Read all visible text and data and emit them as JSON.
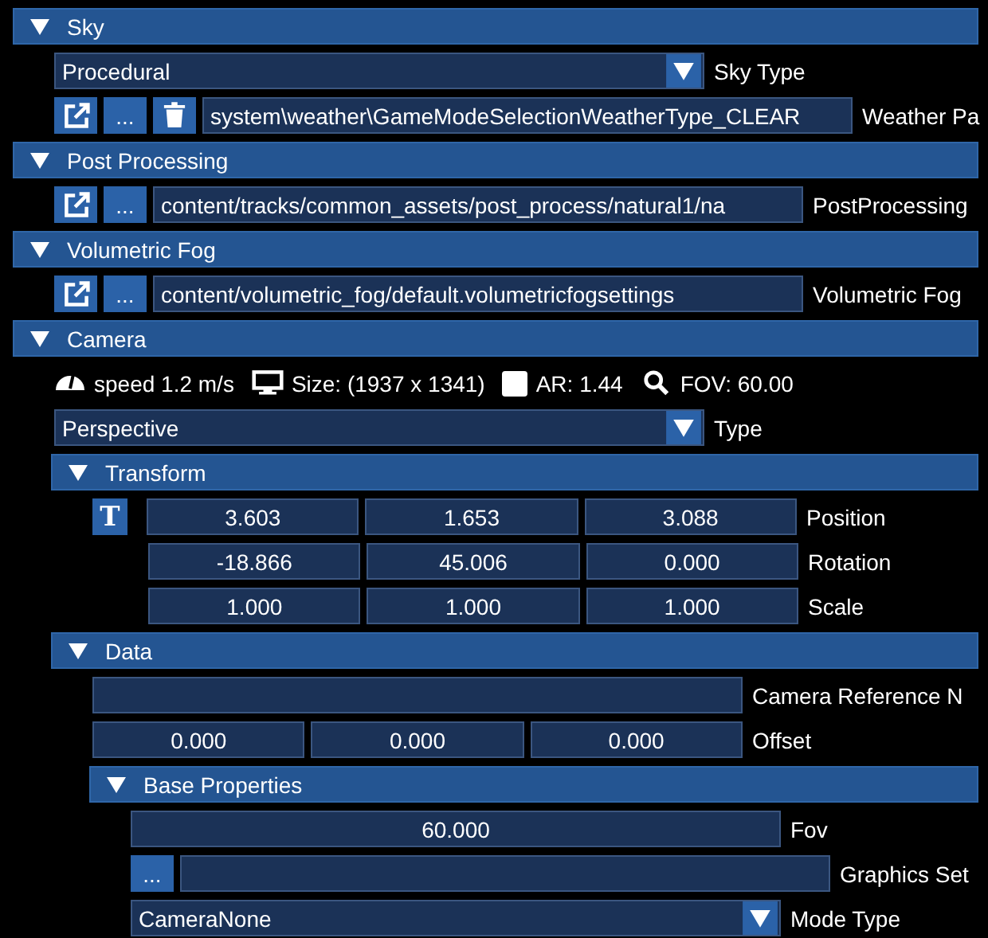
{
  "sections": [
    {
      "title": "Sky",
      "expanded": true,
      "rows": [
        {
          "kind": "dropdown",
          "value": "Procedural",
          "label": "Sky Type"
        },
        {
          "kind": "asset",
          "buttons": [
            {
              "kind": "open"
            },
            {
              "kind": "browse",
              "text": "..."
            },
            {
              "kind": "delete"
            }
          ],
          "value": "system\\weather\\GameModeSelectionWeatherType_CLEAR",
          "label": "Weather Pa"
        }
      ]
    },
    {
      "title": "Post Processing",
      "expanded": true,
      "rows": [
        {
          "kind": "asset",
          "buttons": [
            {
              "kind": "open"
            },
            {
              "kind": "browse",
              "text": "..."
            }
          ],
          "value": "content/tracks/common_assets/post_process/natural1/na",
          "label": "PostProcessing"
        }
      ]
    },
    {
      "title": "Volumetric Fog",
      "expanded": true,
      "rows": [
        {
          "kind": "asset",
          "buttons": [
            {
              "kind": "open"
            },
            {
              "kind": "browse",
              "text": "..."
            }
          ],
          "value": "content/volumetric_fog/default.volumetricfogsettings",
          "label": "Volumetric Fog"
        }
      ]
    },
    {
      "title": "Camera",
      "expanded": true,
      "rows": [
        {
          "kind": "stats",
          "items": [
            {
              "kind": "speed",
              "text": "speed 1.2 m/s"
            },
            {
              "kind": "size",
              "text": "Size: (1937 x 1341)"
            },
            {
              "kind": "aspect",
              "text": "AR: 1.44"
            },
            {
              "kind": "fov",
              "text": "FOV: 60.00"
            }
          ]
        },
        {
          "kind": "dropdown",
          "value": "Perspective",
          "label": "Type"
        },
        {
          "kind": "section",
          "title": "Transform",
          "expanded": true,
          "lead_column": true,
          "rows": [
            {
              "kind": "vector",
              "lead": "T",
              "values": [
                "3.603",
                "1.653",
                "3.088"
              ],
              "label": "Position"
            },
            {
              "kind": "vector",
              "values": [
                "-18.866",
                "45.006",
                "0.000"
              ],
              "label": "Rotation"
            },
            {
              "kind": "vector",
              "values": [
                "1.000",
                "1.000",
                "1.000"
              ],
              "label": "Scale"
            }
          ]
        },
        {
          "kind": "section",
          "title": "Data",
          "expanded": true,
          "rows": [
            {
              "kind": "text",
              "label": "Camera Reference N"
            },
            {
              "kind": "vector",
              "values": [
                "0.000",
                "0.000",
                "0.000"
              ],
              "label": "Offset"
            },
            {
              "kind": "section",
              "title": "Base Properties",
              "expanded": true,
              "rows": [
                {
                  "kind": "number",
                  "value": "60.000",
                  "label": "Fov"
                },
                {
                  "kind": "asset",
                  "buttons": [
                    {
                      "kind": "browse",
                      "text": "..."
                    }
                  ],
                  "label": "Graphics Set"
                },
                {
                  "kind": "dropdown",
                  "value": "CameraNone",
                  "label": "Mode Type"
                }
              ]
            }
          ]
        }
      ]
    }
  ]
}
